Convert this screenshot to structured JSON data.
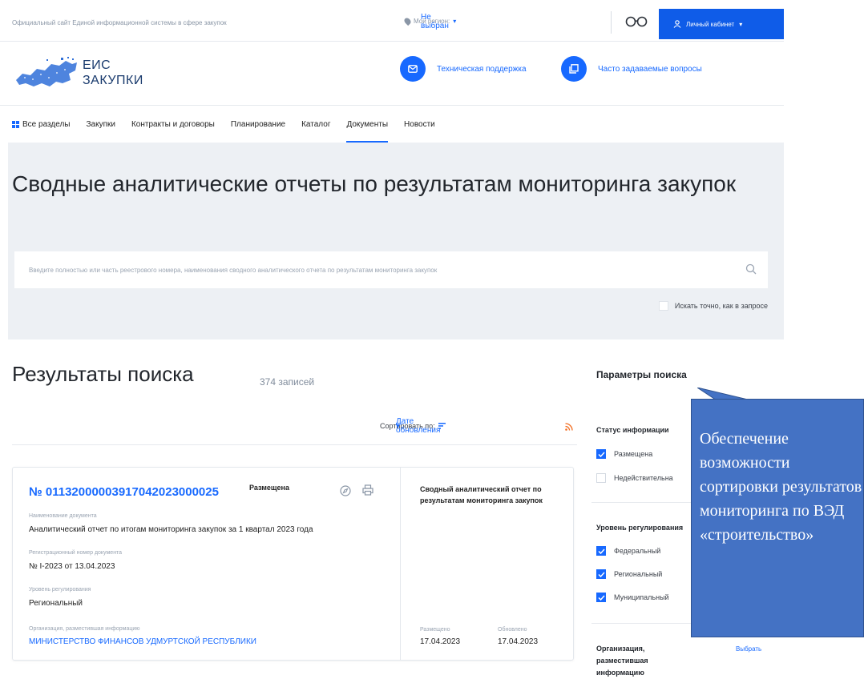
{
  "topbar": {
    "official_site": "Официальный сайт Единой информационной системы в сфере закупок",
    "region_label": "Мой регион:",
    "region_value": "Не выбран",
    "cabinet_label": "Личный кабинет"
  },
  "header": {
    "logo_line1": "ЕИС",
    "logo_line2": "ЗАКУПКИ",
    "support": "Техническая поддержка",
    "faq": "Часто задаваемые вопросы"
  },
  "nav": {
    "all_sections": "Все разделы",
    "items": [
      "Закупки",
      "Контракты и договоры",
      "Планирование",
      "Каталог",
      "Документы",
      "Новости"
    ],
    "active": "Документы"
  },
  "hero": {
    "title": "Сводные аналитические отчеты по результатам мониторинга закупок",
    "search_placeholder": "Введите полностью или часть реестрового номера, наименования сводного аналитического отчета по результатам мониторинга закупок",
    "exact_label": "Искать точно, как в запросе"
  },
  "results": {
    "title": "Результаты поиска",
    "count": "374 записей",
    "sort_label": "Сортировать по:",
    "sort_value": "Дате обновления"
  },
  "card": {
    "number": "№ 01132000003917042023000025",
    "status": "Размещена",
    "doc_name_label": "Наименование документа",
    "doc_name": "Аналитический отчет по итогам мониторинга закупок за 1 квартал 2023 года",
    "reg_label": "Регистрационный номер документа",
    "reg_value": "№ I-2023 от 13.04.2023",
    "level_label": "Уровень регулирования",
    "level_value": "Региональный",
    "org_label": "Организация, разместившая информацию",
    "org_value": "МИНИСТЕРСТВО ФИНАНСОВ УДМУРТСКОЙ РЕСПУБЛИКИ",
    "right_title": "Сводный аналитический отчет по результатам мониторинга закупок",
    "placed_label": "Размещено",
    "placed_value": "17.04.2023",
    "updated_label": "Обновлено",
    "updated_value": "17.04.2023"
  },
  "filters": {
    "title": "Параметры поиска",
    "status_title": "Статус информации",
    "status_options": [
      {
        "label": "Размещена",
        "checked": true
      },
      {
        "label": "Недействительна",
        "checked": false
      }
    ],
    "level_title": "Уровень регулирования",
    "level_options": [
      {
        "label": "Федеральный",
        "checked": true
      },
      {
        "label": "Региональный",
        "checked": true
      },
      {
        "label": "Муниципальный",
        "checked": true
      }
    ],
    "org_title": "Организация, разместившая информацию",
    "org_choose": "Выбрать"
  },
  "callout": {
    "text": "Обеспечение возможности сортировки результатов мониторинга по ВЭД «строительство»"
  },
  "colors": {
    "accent": "#1769ff",
    "cabinet_bg": "#0f5ce8",
    "hero_bg": "#edf0f4",
    "callout_bg": "#4472c4"
  }
}
